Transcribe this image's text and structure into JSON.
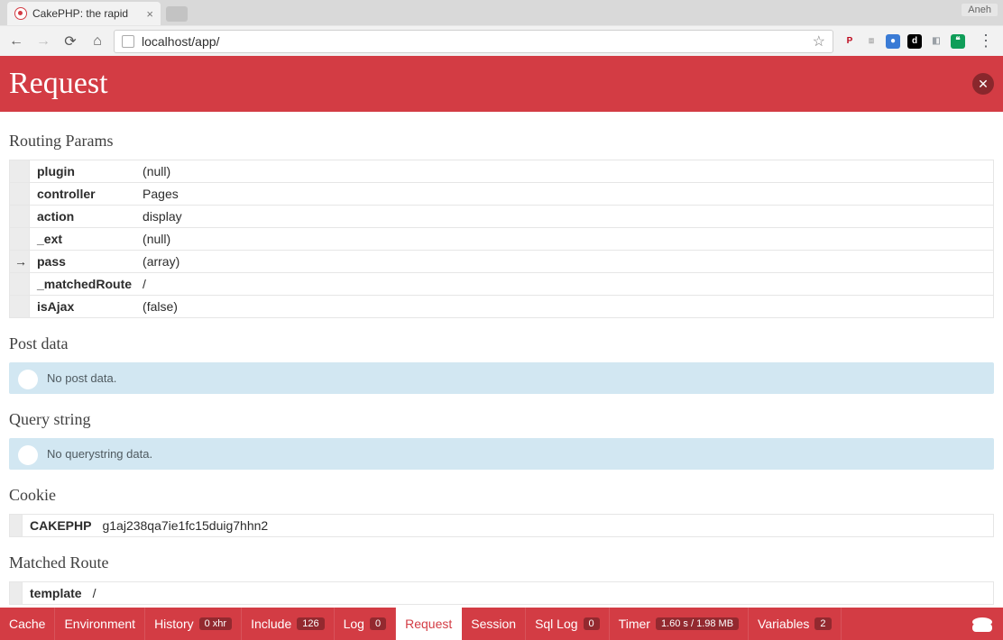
{
  "browser": {
    "tab_title": "CakePHP: the rapid",
    "profile": "Aneh",
    "url_host": "localhost",
    "url_path": "/app/"
  },
  "header": {
    "title": "Request"
  },
  "sections": {
    "routing_params": {
      "label": "Routing Params",
      "rows": [
        {
          "key": "plugin",
          "value": "(null)",
          "expandable": false
        },
        {
          "key": "controller",
          "value": "Pages",
          "expandable": false
        },
        {
          "key": "action",
          "value": "display",
          "expandable": false
        },
        {
          "key": "_ext",
          "value": "(null)",
          "expandable": false
        },
        {
          "key": "pass",
          "value": "(array)",
          "expandable": true
        },
        {
          "key": "_matchedRoute",
          "value": "/",
          "expandable": false
        },
        {
          "key": "isAjax",
          "value": "(false)",
          "expandable": false
        }
      ]
    },
    "post_data": {
      "label": "Post data",
      "message": "No post data."
    },
    "query_string": {
      "label": "Query string",
      "message": "No querystring data."
    },
    "cookie": {
      "label": "Cookie",
      "rows": [
        {
          "key": "CAKEPHP",
          "value": "g1aj238qa7ie1fc15duig7hhn2"
        }
      ]
    },
    "matched_route": {
      "label": "Matched Route",
      "rows": [
        {
          "key": "template",
          "value": "/"
        }
      ]
    }
  },
  "debug_bar": {
    "items": [
      {
        "label": "Cache",
        "badge": null,
        "active": false
      },
      {
        "label": "Environment",
        "badge": null,
        "active": false
      },
      {
        "label": "History",
        "badge": "0 xhr",
        "active": false
      },
      {
        "label": "Include",
        "badge": "126",
        "active": false
      },
      {
        "label": "Log",
        "badge": "0",
        "active": false
      },
      {
        "label": "Request",
        "badge": null,
        "active": true
      },
      {
        "label": "Session",
        "badge": null,
        "active": false
      },
      {
        "label": "Sql Log",
        "badge": "0",
        "active": false
      },
      {
        "label": "Timer",
        "badge": "1.60 s / 1.98 MB",
        "active": false
      },
      {
        "label": "Variables",
        "badge": "2",
        "active": false
      }
    ]
  },
  "ext_icons": [
    {
      "name": "pinterest-icon",
      "bg": "transparent",
      "fg": "#bd081c",
      "char": "P"
    },
    {
      "name": "dropbox-icon",
      "bg": "transparent",
      "fg": "#b8b8b8",
      "char": "⧈"
    },
    {
      "name": "lastpass-icon",
      "bg": "#3a7bd5",
      "fg": "#fff",
      "char": "●"
    },
    {
      "name": "digg-icon",
      "bg": "#000",
      "fg": "#fff",
      "char": "d"
    },
    {
      "name": "bookmark-icon",
      "bg": "transparent",
      "fg": "#9aa0a6",
      "char": "◧"
    },
    {
      "name": "hangouts-icon",
      "bg": "#0f9d58",
      "fg": "#fff",
      "char": "❝"
    }
  ]
}
